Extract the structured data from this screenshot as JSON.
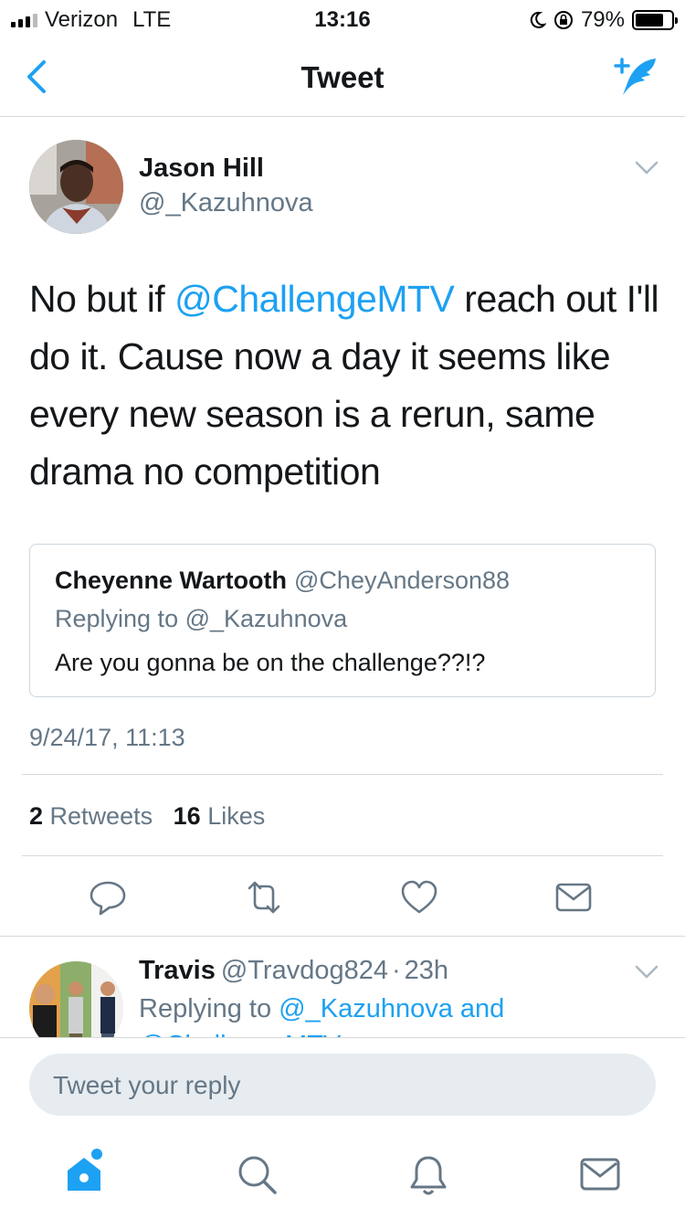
{
  "status_bar": {
    "carrier": "Verizon",
    "network": "LTE",
    "time": "13:16",
    "battery_percent": "79%",
    "battery_level": 0.79
  },
  "nav": {
    "title": "Tweet",
    "back_icon": "chevron-left-icon",
    "compose_icon": "compose-tweet-icon"
  },
  "tweet": {
    "name": "Jason Hill",
    "handle": "@_Kazuhnova",
    "text_before": "No but if ",
    "mention": "@ChallengeMTV",
    "text_after": " reach out I'll do it. Cause now a day it seems like every new season is a rerun, same drama no competition",
    "timestamp": "9/24/17, 11:13",
    "retweets_count": "2",
    "retweets_label": "Retweets",
    "likes_count": "16",
    "likes_label": "Likes"
  },
  "quoted": {
    "name": "Cheyenne Wartooth",
    "handle": "@CheyAnderson88",
    "replying": "Replying to @_Kazuhnova",
    "text": "Are you gonna be on the challenge??!?"
  },
  "reply_tweet": {
    "name": "Travis",
    "handle": "@Travdog824",
    "separator": "·",
    "time": "23h",
    "replying_prefix": "Replying to ",
    "replying_to": "@_Kazuhnova and",
    "replying_cut": "@ChallengeMTV"
  },
  "composer": {
    "placeholder": "Tweet your reply"
  },
  "colors": {
    "accent": "#1da1f2",
    "muted": "#657786",
    "border": "#d8d8d8"
  }
}
